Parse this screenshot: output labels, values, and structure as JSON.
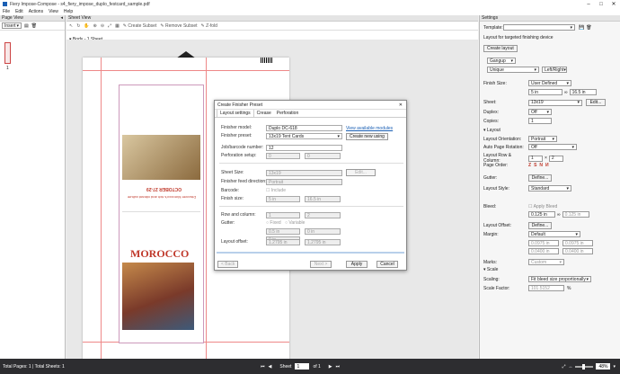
{
  "app": {
    "title": "Fiery Impose-Compose - s4_fiery_impose_duplo_festcard_sample.pdf",
    "menu": [
      "File",
      "Edit",
      "Actions",
      "View",
      "Help"
    ]
  },
  "page_view": {
    "header": "Page View",
    "mode": "Insert",
    "thumb_label": "1"
  },
  "sheet_view": {
    "header": "Sheet View",
    "toolbar": {
      "create_subset": "Create Subset",
      "remove_subset": "Remove Subset",
      "fold": "Z-fold"
    },
    "breadcrumb": "Body - 1 Sheet",
    "card": {
      "date": "OCTOBER 27-29",
      "tagline": "Discover Morocco's rich and vibrant culture",
      "headline": "MOROCCO"
    }
  },
  "settings": {
    "header": "Settings",
    "template_label": "Template:",
    "template_value": "",
    "layout_note": "Layout for targeted finishing device",
    "create_layout": "Create layout",
    "binding": "Gangup",
    "mode": "Unique",
    "direction": "Left/Right",
    "finish_size_label": "Finish Size:",
    "finish_size_value": "User Defined",
    "finish_w": "5 in",
    "finish_h": "16.5 in",
    "sheet_label": "Sheet:",
    "sheet_value": "13x19",
    "edit_label": "Edit...",
    "duplex_label": "Duplex:",
    "duplex_value": "Off",
    "copies_label": "Copies:",
    "copies_value": "1",
    "layout_section": "Layout",
    "orientation_label": "Layout Orientation:",
    "orientation_value": "Portrait",
    "auto_rotation_label": "Auto Page Rotation:",
    "auto_rotation_value": "Off",
    "rowcol_label": "Layout Row & Column:",
    "row_value": "1",
    "col_value": "2",
    "page_order_label": "Page Order:",
    "gutter_label": "Gutter:",
    "define_label": "Define...",
    "style_label": "Layout Style:",
    "style_value": "Standard",
    "bleed_label": "Bleed:",
    "apply_bleed": "Apply Bleed",
    "bleed_a": "0.125 in",
    "bleed_b": "0.125 in",
    "offset_label": "Layout Offset:",
    "offset_define": "Define...",
    "margin_label": "Margin:",
    "margin_value": "Default",
    "margin_1": "0.0975 in",
    "margin_2": "0.0975 in",
    "margin_3": "0.0400 in",
    "margin_4": "0.0400 in",
    "marks_label": "Marks:",
    "marks_value": "Custom",
    "scale_section": "Scale",
    "scaling_label": "Scaling:",
    "scaling_value": "Fit bleed size proportionally",
    "scale_factor_label": "Scale Factor:",
    "scale_factor_value": "101.5152",
    "scale_unit": "%"
  },
  "dialog": {
    "title": "Create Finisher Preset",
    "tabs": [
      "Layout settings",
      "Crease",
      "Perforation"
    ],
    "finisher_model_label": "Finisher model:",
    "finisher_model_value": "Duplo DC-618",
    "view_modules": "View available modules",
    "finisher_preset_label": "Finisher preset:",
    "finisher_preset_value": "13x19 Tent Cards",
    "create_new": "Create new using",
    "job_barcode_label": "Job/barcode number:",
    "job_barcode_value": "12",
    "perforation_label": "Perforation setup:",
    "perf_a": "0",
    "perf_b": "0",
    "sheet_size_label": "Sheet Size:",
    "sheet_size_value": "13x19",
    "edit": "Edit...",
    "feed_dir_label": "Finisher feed direction:",
    "feed_dir_value": "Portrait",
    "barcode_label": "Barcode:",
    "barcode_include": "Include",
    "finish_size_label": "Finish size:",
    "fs_w": "5 in",
    "fs_h": "16.5 in",
    "rowcol_label": "Row and column:",
    "rc_a": "1",
    "rc_b": "2",
    "gutter_label": "Gutter:",
    "gutter_fixed": "Fixed",
    "gutter_variable": "Variable",
    "g_a": "0.5 in",
    "g_b": "0 in",
    "g_c": "0 in",
    "offset_label": "Layout offset:",
    "off_a": "1.2795 in",
    "off_b": "1.2795 in",
    "back": "< Back",
    "next": "Next >",
    "apply": "Apply",
    "cancel": "Cancel"
  },
  "status": {
    "total": "Total Pages: 1 | Total Sheets: 1",
    "sheet_label": "Sheet",
    "sheet_value": "1",
    "of": "of 1",
    "zoom": "48%"
  },
  "colors": {
    "accent_red": "#c0392b",
    "status_bg": "#2d2d30"
  }
}
